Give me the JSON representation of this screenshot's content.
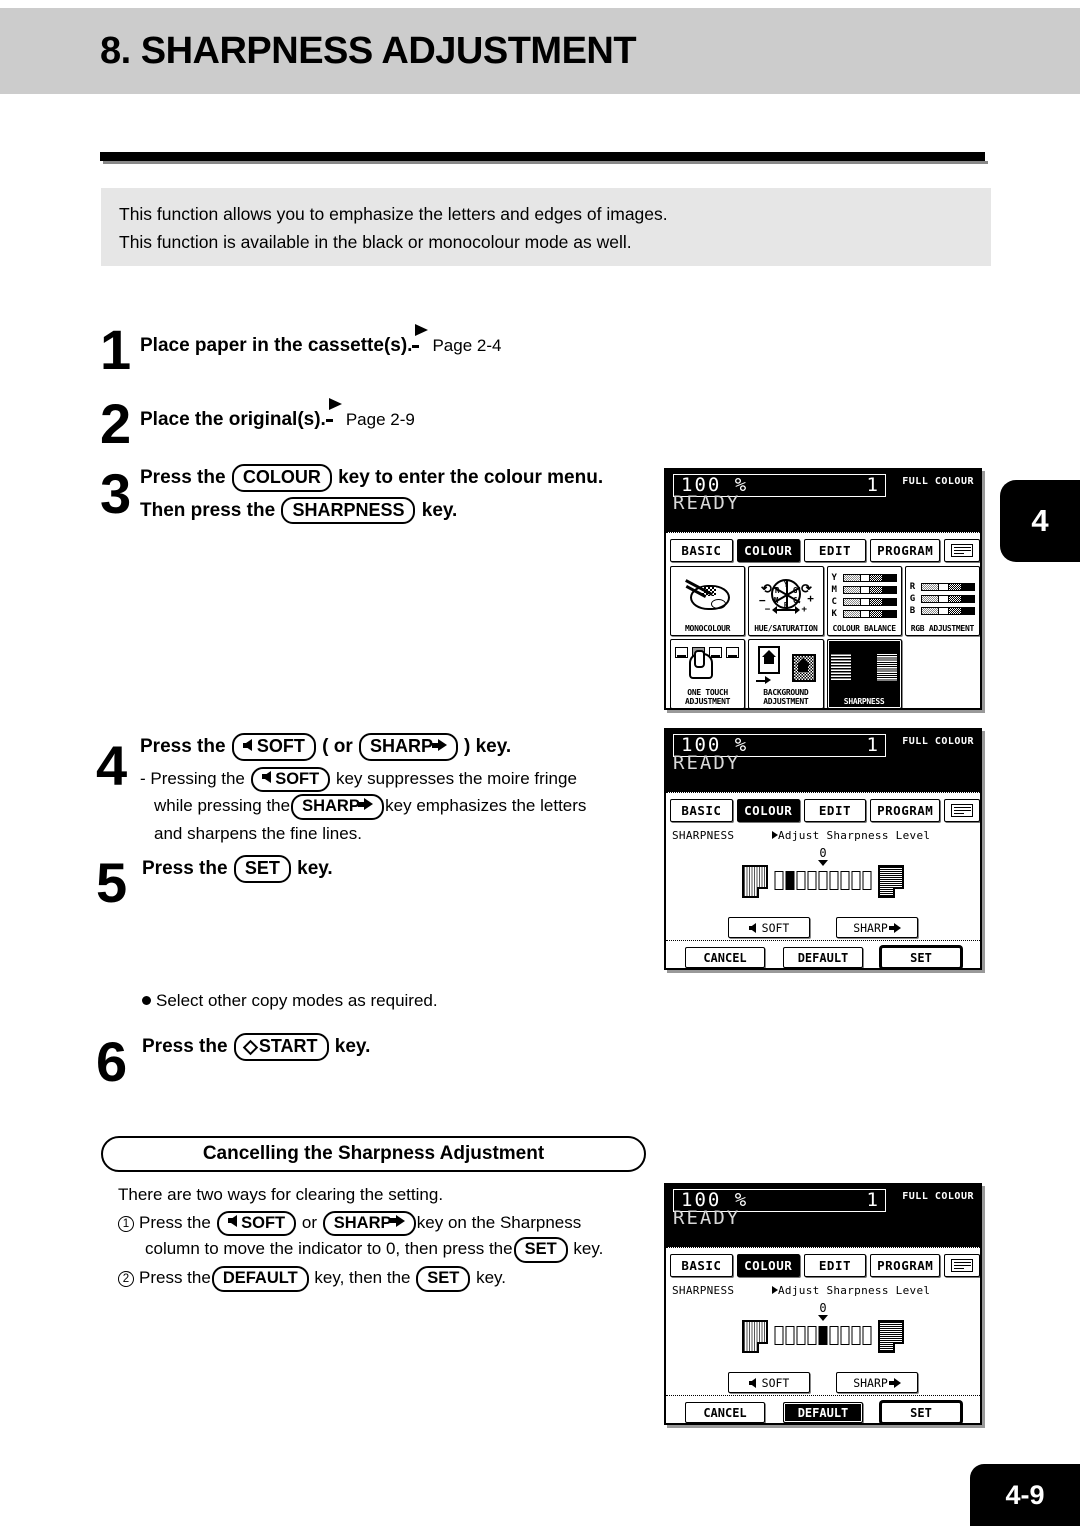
{
  "header": {
    "title": "8. SHARPNESS ADJUSTMENT"
  },
  "intro": {
    "line1": "This function allows you to emphasize the letters and edges of images.",
    "line2": "This function is available in the black or monocolour mode as well."
  },
  "steps": [
    {
      "num": "1",
      "text_a": "Place paper in the cassette(s).",
      "ref": "Page 2-4"
    },
    {
      "num": "2",
      "text_a": "Place the original(s).",
      "ref": "Page 2-9"
    },
    {
      "num": "3",
      "line1_a": "Press the",
      "key1": "COLOUR",
      "line1_b": "key to enter the colour menu.",
      "line2_a": "Then press the",
      "key2": "SHARPNESS",
      "line2_b": "key."
    },
    {
      "num": "4",
      "line1_a": "Press the",
      "key_soft": "SOFT",
      "line1_mid": "( or",
      "key_sharp": "SHARP",
      "line1_b": ") key.",
      "sub_a": "-  Pressing the",
      "sub_b": "key suppresses the moire fringe",
      "sub_c": "while pressing the",
      "sub_d": "key emphasizes the letters",
      "sub_e": "and sharpens the fine lines."
    },
    {
      "num": "5",
      "line1_a": "Press the",
      "key_set": "SET",
      "line1_b": "key."
    },
    {
      "num": "6",
      "line1_a": "Press the",
      "key_start": "START",
      "line1_b": "key."
    }
  ],
  "bullet": {
    "text": "Select other copy modes as required."
  },
  "cancelling": {
    "pill_title": "Cancelling the Sharpness Adjustment",
    "intro": "There are two ways for clearing the setting.",
    "item1_num": "1",
    "item1_a": "Press the",
    "item1_soft": "SOFT",
    "item1_or": "or",
    "item1_sharp": "SHARP",
    "item1_b": "key on the Sharpness",
    "item1_c": "column to move the indicator to 0, then press the",
    "item1_set": "SET",
    "item1_d": "key.",
    "item2_num": "2",
    "item2_a": "Press the",
    "item2_default": "DEFAULT",
    "item2_b": "key, then the",
    "item2_set": "SET",
    "item2_c": "key."
  },
  "tabs_marker": {
    "chapter": "4",
    "page": "4-9"
  },
  "lcd_common": {
    "zoom_percent": "100 %",
    "copies": "1",
    "colour_mode": "FULL COLOUR",
    "status": "READY",
    "tabs": [
      {
        "label": "BASIC",
        "selected": false
      },
      {
        "label": "COLOUR",
        "selected": true
      },
      {
        "label": "EDIT",
        "selected": false
      },
      {
        "label": "PROGRAM",
        "selected": false
      },
      {
        "label": "keyboard-icon",
        "selected": false
      }
    ]
  },
  "lcd_colour_menu": {
    "buttons": [
      {
        "label": "MONOCOLOUR",
        "icon": "palette-icon",
        "selected": false
      },
      {
        "label": "HUE/SATURATION",
        "icon": "colour-wheel-icon",
        "selected": false
      },
      {
        "label": "COLOUR BALANCE",
        "icon": "ymck-bars-icon",
        "selected": false,
        "rows": [
          "Y",
          "M",
          "C",
          "K"
        ]
      },
      {
        "label": "RGB ADJUSTMENT",
        "icon": "rgb-bars-icon",
        "selected": false,
        "rows": [
          "R",
          "G",
          "B"
        ]
      },
      {
        "label": "ONE TOUCH ADJUSTMENT",
        "icon": "one-touch-icon",
        "selected": false
      },
      {
        "label": "BACKGROUND ADJUSTMENT",
        "icon": "background-icon",
        "selected": false
      },
      {
        "label": "SHARPNESS",
        "icon": "sharpness-icon",
        "selected": true
      }
    ]
  },
  "lcd_sharpness_soft": {
    "screen_name": "SHARPNESS",
    "prompt": "Adjust Sharpness Level",
    "zero_label": "0",
    "cells": 9,
    "active_cell": 2,
    "zero_cell": 5,
    "soft_label": "SOFT",
    "sharp_label": "SHARP",
    "buttons": [
      {
        "label": "CANCEL",
        "selected": false,
        "focus": false
      },
      {
        "label": "DEFAULT",
        "selected": false,
        "focus": false
      },
      {
        "label": "SET",
        "selected": false,
        "focus": true
      }
    ]
  },
  "lcd_sharpness_default": {
    "screen_name": "SHARPNESS",
    "prompt": "Adjust Sharpness Level",
    "zero_label": "0",
    "cells": 9,
    "active_cell": 5,
    "zero_cell": 5,
    "soft_label": "SOFT",
    "sharp_label": "SHARP",
    "buttons": [
      {
        "label": "CANCEL",
        "selected": false,
        "focus": false
      },
      {
        "label": "DEFAULT",
        "selected": true,
        "focus": false
      },
      {
        "label": "SET",
        "selected": false,
        "focus": true
      }
    ]
  }
}
